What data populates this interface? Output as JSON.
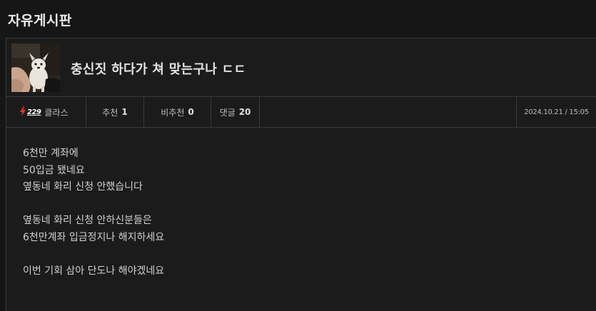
{
  "board": {
    "title": "자유게시판"
  },
  "post": {
    "title": "충신짓 하다가 쳐 맞는구나 ㄷㄷ",
    "thumbnail_icon": "dog-photo-thumbnail",
    "author": {
      "level": "229",
      "level_icon": "lightning-bolt-icon",
      "name": "클라스"
    },
    "recommend_label": "추천",
    "recommend_count": "1",
    "not_recommend_label": "비추천",
    "not_recommend_count": "0",
    "comments_label": "댓글",
    "comments_count": "20",
    "date": "2024.10.21 / 15:05",
    "body": {
      "paragraphs": [
        [
          "6천만 계좌에",
          "50입금 됐네요",
          "옆동네 화리 신청 안했습니다"
        ],
        [
          "옆동네 화리 신청 안하신분들은",
          "6천만계좌 입금정지나 해지하세요"
        ],
        [
          "이번 기회 삼아 단도나 해야겠네요"
        ]
      ]
    }
  },
  "colors": {
    "background": "#161616",
    "panel": "#1b1b1b",
    "border": "#3a3a3a",
    "level_bolt": "#e8352b"
  }
}
